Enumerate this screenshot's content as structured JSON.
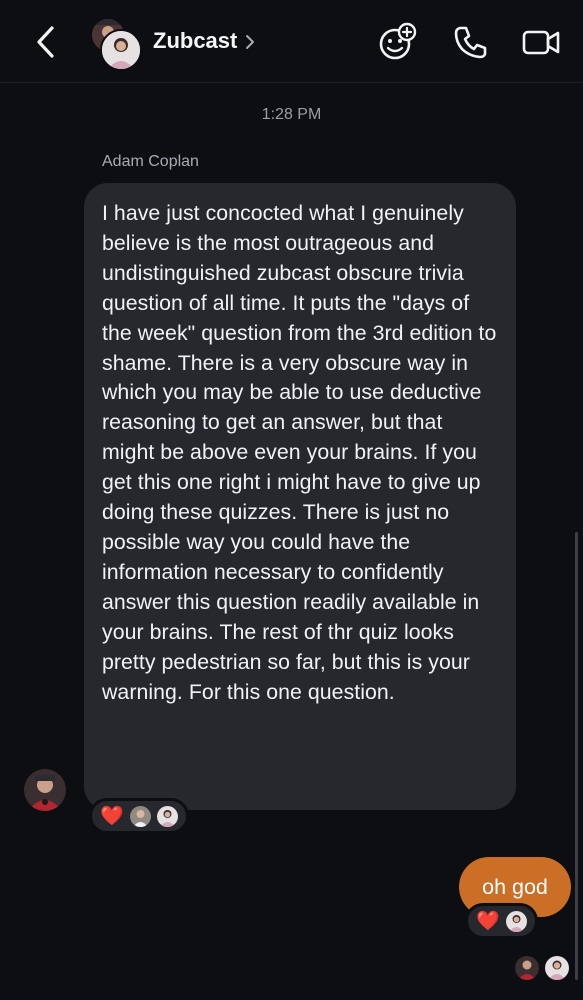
{
  "header": {
    "title": "Zubcast",
    "icons": [
      "back-icon",
      "chevron-right-icon",
      "add-person-icon",
      "phone-icon",
      "video-call-icon"
    ]
  },
  "conversation": {
    "timestamp": "1:28 PM",
    "messages": [
      {
        "sender": "Adam Coplan",
        "text": "I have just concocted what I genuinely believe is the most outrageous and undistinguished zubcast obscure trivia question of all time. It puts the \"days of the week\" question from the 3rd edition to shame. There is a very obscure way in which you may be able to use deductive reasoning to get an answer, but that might be above even your brains. If you get this one right i might have to give up doing these quizzes. There is just no possible way you could have the information necessary to confidently answer this question readily available in your brains. The rest of thr quiz looks pretty pedestrian so far, but this is your warning. For this one question.",
        "reactions": [
          "❤️"
        ]
      },
      {
        "sender": "me",
        "text": "oh god",
        "reactions": [
          "❤️"
        ]
      }
    ]
  },
  "colors": {
    "background": "#0c0e12",
    "incoming_bubble": "#26282d",
    "outgoing_bubble": "#cc6f26",
    "heart": "#ff2d3a"
  }
}
